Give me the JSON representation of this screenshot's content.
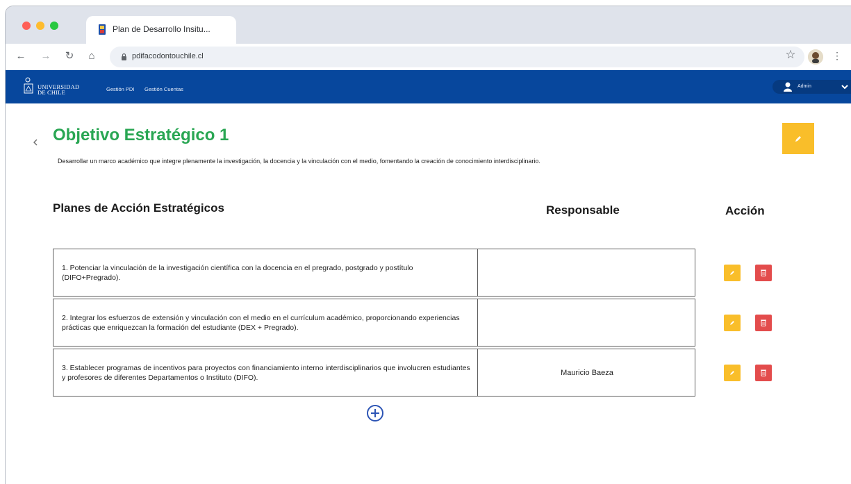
{
  "browser": {
    "tab_title": "Plan de Desarrollo Insitu...",
    "url": "pdifacodontouchile.cl"
  },
  "app_nav": {
    "logo_line1": "UNIVERSIDAD",
    "logo_line2": "DE CHILE",
    "links": [
      "Gestión PDI",
      "Gestión Cuentas"
    ],
    "user_label": "Admin"
  },
  "objective": {
    "title": "Objetivo Estratégico 1",
    "description": "Desarrollar un marco académico que integre plenamente la investigación, la docencia y la vinculación con el medio, fomentando la creación de conocimiento interdisciplinario."
  },
  "table": {
    "heading": "Planes de Acción Estratégicos",
    "col_responsable": "Responsable",
    "col_accion": "Acción",
    "rows": [
      {
        "plan": "1. Potenciar la vinculación de la investigación científica con la docencia en el pregrado, postgrado y postítulo (DIFO+Pregrado).",
        "responsable": ""
      },
      {
        "plan": "2. Integrar los esfuerzos de extensión y vinculación con el medio en el currículum académico, proporcionando experiencias prácticas que enriquezcan la formación del estudiante (DEX + Pregrado).",
        "responsable": ""
      },
      {
        "plan": "3. Establecer programas de incentivos para proyectos con financiamiento interno interdisciplinarios que involucren estudiantes y profesores de diferentes Departamentos o Instituto (DIFO).",
        "responsable": "Mauricio Baeza"
      }
    ]
  },
  "colors": {
    "app_bar": "#07479d",
    "title_green": "#29a653",
    "edit_yellow": "#f9be2a",
    "delete_red": "#e34c4c",
    "add_blue": "#2d55b5"
  },
  "icons": {
    "back": "chevron-left-icon",
    "edit": "pencil-icon",
    "delete": "trash-icon",
    "add": "plus-circle-icon"
  }
}
